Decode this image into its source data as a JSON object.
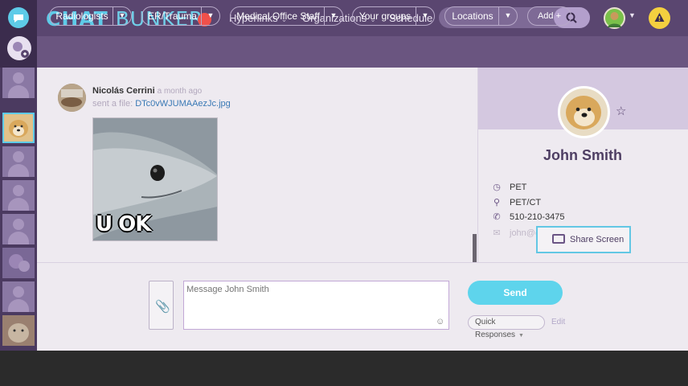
{
  "app": {
    "logo_bold": "CHAT",
    "logo_thin": "BUNKER"
  },
  "nav": {
    "hyperlinks": "Hyperlinks",
    "organizations": "Organizations",
    "schedule": "Schedule"
  },
  "filters": [
    {
      "label": "Radiologists"
    },
    {
      "label": "ER/Trauma"
    },
    {
      "label": "Medical Office Staff"
    },
    {
      "label": "Your groups"
    },
    {
      "label": "Locations"
    }
  ],
  "add_label": "Add +",
  "message": {
    "sender": "Nicolás Cerrini",
    "time": "a month ago",
    "sent_prefix": "sent a file:",
    "file_name": "DTc0vWJUMAAezJc.jpg",
    "meme_text": "U OK"
  },
  "profile": {
    "name": "John Smith",
    "info": [
      {
        "icon": "clock-icon",
        "text": "PET"
      },
      {
        "icon": "location-pin-icon",
        "text": "PET/CT"
      },
      {
        "icon": "phone-icon",
        "text": "510-210-3475"
      },
      {
        "icon": "envelope-icon",
        "text": "john@c"
      }
    ],
    "share_label": "Share Screen"
  },
  "composer": {
    "placeholder": "Message John Smith",
    "send_label": "Send",
    "quick_responses": "Quick Responses",
    "edit_label": "Edit"
  },
  "colors": {
    "topbar": "#5a4670",
    "accent_cyan": "#5ed4ec",
    "record": "#f0504a",
    "warning": "#f4d03f"
  }
}
